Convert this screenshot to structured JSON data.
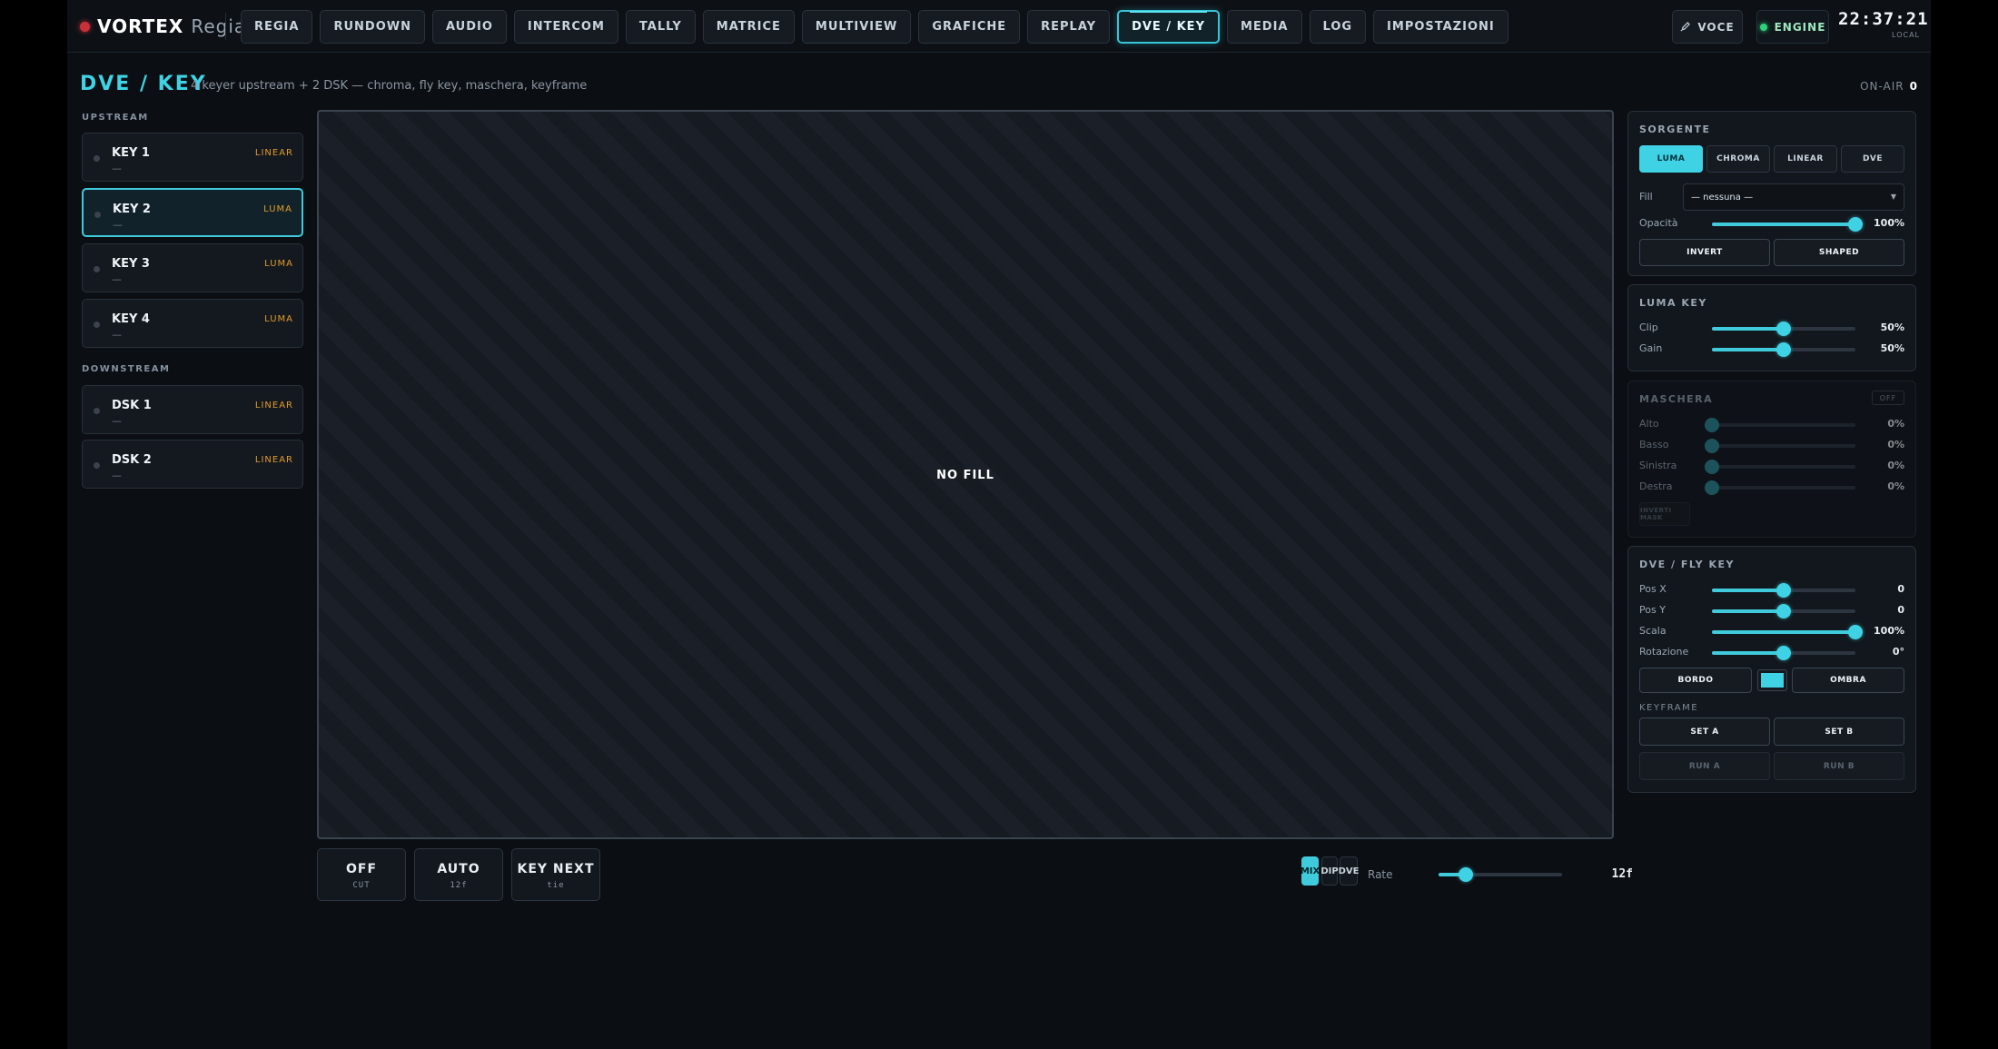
{
  "brand": {
    "name": "VORTEX",
    "sub": "Regia"
  },
  "nav": {
    "tabs": [
      "REGIA",
      "RUNDOWN",
      "AUDIO",
      "INTERCOM",
      "TALLY",
      "MATRICE",
      "MULTIVIEW",
      "GRAFICHE",
      "REPLAY",
      "DVE / KEY",
      "MEDIA",
      "LOG",
      "IMPOSTAZIONI"
    ],
    "active": "DVE / KEY"
  },
  "topbar": {
    "voice_label": "VOCE",
    "engine_label": "ENGINE",
    "clock_time": "22:37:21",
    "clock_zone": "LOCAL"
  },
  "header": {
    "title": "DVE / KEY",
    "subtitle": "4 keyer upstream + 2 DSK — chroma, fly key, maschera, keyframe",
    "onair_label": "ON-AIR",
    "onair_count": "0"
  },
  "upstream": {
    "label": "UPSTREAM",
    "keys": [
      {
        "name": "KEY 1",
        "mode": "LINEAR",
        "fill": "—"
      },
      {
        "name": "KEY 2",
        "mode": "LUMA",
        "fill": "—"
      },
      {
        "name": "KEY 3",
        "mode": "LUMA",
        "fill": "—"
      },
      {
        "name": "KEY 4",
        "mode": "LUMA",
        "fill": "—"
      }
    ]
  },
  "downstream": {
    "label": "DOWNSTREAM",
    "keys": [
      {
        "name": "DSK 1",
        "mode": "LINEAR",
        "fill": "—"
      },
      {
        "name": "DSK 2",
        "mode": "LINEAR",
        "fill": "—"
      }
    ]
  },
  "preview": {
    "text": "NO FILL"
  },
  "transport": {
    "buttons": [
      {
        "label": "OFF",
        "sub": "CUT"
      },
      {
        "label": "AUTO",
        "sub": "12f"
      },
      {
        "label": "KEY NEXT",
        "sub": "tie"
      }
    ],
    "transitions": [
      "MIX",
      "DIP",
      "DVE"
    ],
    "active_transition": "MIX",
    "rate_label": "Rate",
    "rate_value": "12f",
    "rate_level": 0.22
  },
  "sorgente": {
    "title": "SORGENTE",
    "types": [
      "LUMA",
      "CHROMA",
      "LINEAR",
      "DVE"
    ],
    "active_type": "LUMA",
    "fill_label": "Fill",
    "fill_value": "— nessuna —",
    "opacity_label": "Opacità",
    "opacity_value": "100%",
    "opacity_level": 1.0,
    "invert_label": "INVERT",
    "shaped_label": "SHAPED"
  },
  "luma_key": {
    "title": "LUMA KEY",
    "rows": [
      {
        "label": "Clip",
        "value": "50%",
        "level": 0.5
      },
      {
        "label": "Gain",
        "value": "50%",
        "level": 0.5
      }
    ]
  },
  "maschera": {
    "title": "MASCHERA",
    "state": "OFF",
    "rows": [
      {
        "label": "Alto",
        "value": "0%",
        "level": 0.0
      },
      {
        "label": "Basso",
        "value": "0%",
        "level": 0.0
      },
      {
        "label": "Sinistra",
        "value": "0%",
        "level": 0.0
      },
      {
        "label": "Destra",
        "value": "0%",
        "level": 0.0
      }
    ],
    "invert_label": "INVERTI MASK"
  },
  "dve": {
    "title": "DVE / FLY KEY",
    "rows": [
      {
        "label": "Pos X",
        "value": "0",
        "level": 0.5
      },
      {
        "label": "Pos Y",
        "value": "0",
        "level": 0.5
      },
      {
        "label": "Scala",
        "value": "100%",
        "level": 1.0
      },
      {
        "label": "Rotazione",
        "value": "0°",
        "level": 0.5
      }
    ],
    "border_label": "BORDO",
    "shadow_label": "OMBRA",
    "border_color": "#3fd2e4",
    "keyframe_label": "KEYFRAME",
    "set_a": "SET A",
    "set_b": "SET B",
    "run_a": "RUN A",
    "run_b": "RUN B"
  },
  "colors": {
    "accent": "#3fd2e4",
    "mode_orange": "#e09a2a",
    "tally_red": "#c8303a",
    "engine_green": "#2fd27a"
  }
}
